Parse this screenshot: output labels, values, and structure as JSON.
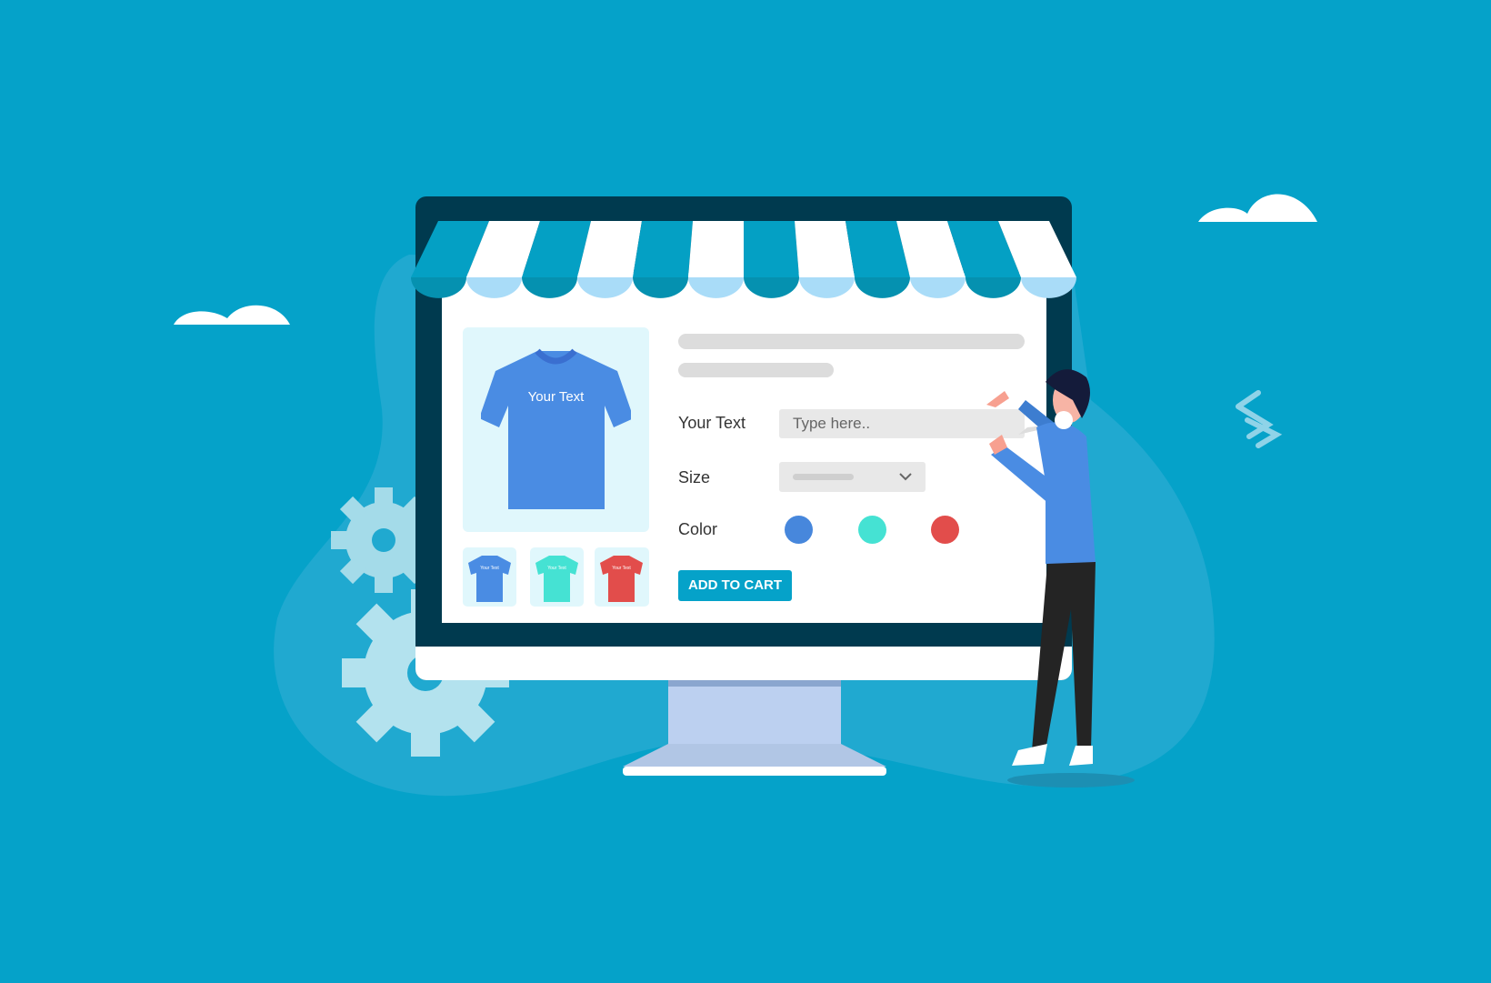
{
  "product": {
    "preview_text": "Your Text",
    "thumbnail_text": "Your Text",
    "fields": {
      "text_label": "Your Text",
      "text_placeholder": "Type here..",
      "size_label": "Size",
      "color_label": "Color"
    },
    "colors": [
      "#4787dc",
      "#45e2d3",
      "#e24d4b"
    ],
    "add_to_cart": "ADD TO CART"
  },
  "theme": {
    "background": "#05a2c9",
    "bezel": "#003a4f",
    "awning_dark": "#04a0c4",
    "awning_light": "#a9dcf8"
  }
}
